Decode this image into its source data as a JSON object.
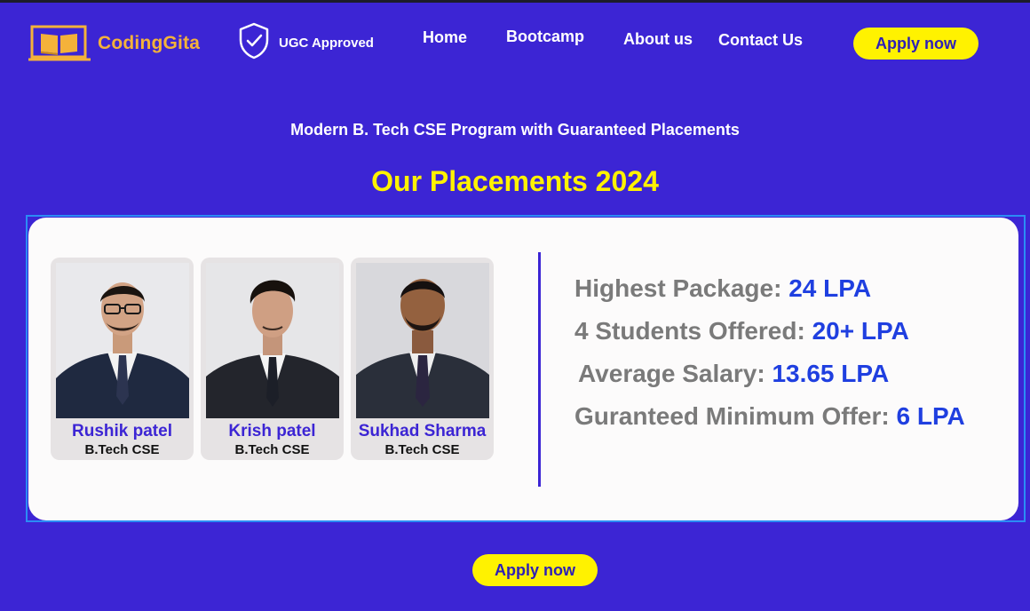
{
  "header": {
    "brand": "CodingGita",
    "badge": "UGC Approved",
    "nav": [
      "Home",
      "Bootcamp",
      "About us",
      "Contact Us"
    ],
    "apply_label": "Apply now"
  },
  "hero": {
    "subtitle": "Modern B. Tech CSE Program with Guaranteed Placements",
    "title": "Our Placements 2024"
  },
  "students": [
    {
      "name": "Rushik patel",
      "degree": "B.Tech CSE"
    },
    {
      "name": "Krish patel",
      "degree": "B.Tech CSE"
    },
    {
      "name": "Sukhad Sharma",
      "degree": "B.Tech CSE"
    }
  ],
  "stats": [
    {
      "label": "Highest Package:",
      "value": "24 LPA"
    },
    {
      "label": "4 Students Offered:",
      "value": "20+ LPA"
    },
    {
      "label": "Average Salary:",
      "value": "13.65 LPA"
    },
    {
      "label": "Guranteed Minimum Offer:",
      "value": "6 LPA"
    }
  ],
  "footer": {
    "apply_label": "Apply now"
  },
  "colors": {
    "background": "#3c25d4",
    "accent_yellow": "#fff200",
    "brand_orange": "#f4b23a",
    "value_blue": "#1f3fe0"
  },
  "icons": [
    "book-logo-icon",
    "shield-check-icon"
  ]
}
